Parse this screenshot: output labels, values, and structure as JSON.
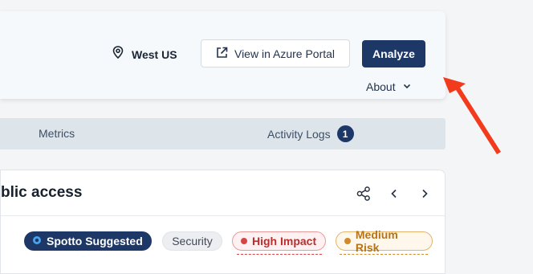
{
  "header": {
    "location": "West US",
    "azure_button": "View in Azure Portal",
    "analyze_button": "Analyze",
    "about": "About"
  },
  "tabs": {
    "metrics": "Metrics",
    "activity_logs": "Activity Logs",
    "activity_count": "1"
  },
  "panel": {
    "title": "blic access",
    "tags": {
      "spotto": "Spotto Suggested",
      "security": "Security",
      "impact": "High Impact",
      "risk": "Medium Risk"
    }
  },
  "colors": {
    "accent": "#1d3766",
    "arrow": "#f23b1c",
    "impact": "#d64545",
    "risk": "#d18a2a"
  },
  "icons": [
    "location-pin-icon",
    "external-link-icon",
    "chevron-down-icon",
    "share-icon",
    "chevron-left-icon",
    "chevron-right-icon",
    "spotto-logo-icon",
    "arrow-annotation"
  ]
}
